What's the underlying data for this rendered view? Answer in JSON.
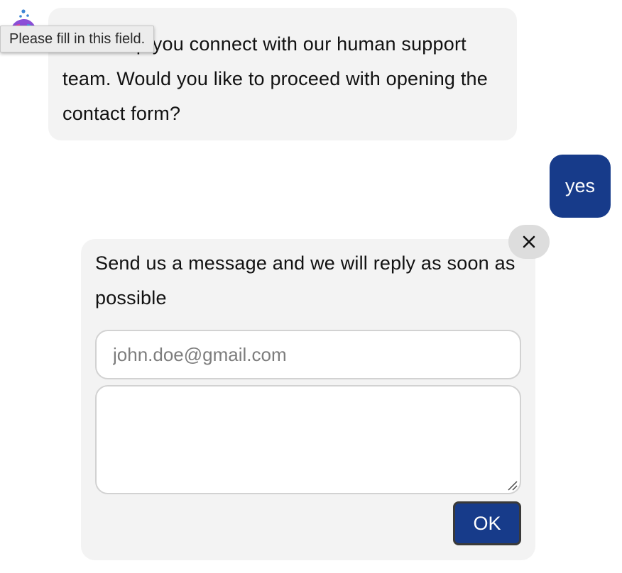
{
  "chat": {
    "bot_message": "I can help you connect with our human support team. Would you like to proceed with opening the contact form?",
    "user_message": "yes"
  },
  "tooltip": {
    "text": "Please fill in this field."
  },
  "contact_form": {
    "intro": "Send us a message and we will reply as soon as possible",
    "email_placeholder": "john.doe@gmail.com",
    "email_value": "",
    "message_value": "",
    "submit_label": "OK"
  },
  "icons": {
    "avatar": "bot-avatar-icon",
    "close": "close-icon",
    "resize": "resize-grip-icon"
  },
  "colors": {
    "accent": "#173b8a",
    "bubble_bg": "#f3f3f3",
    "close_bg": "#dddddd"
  }
}
